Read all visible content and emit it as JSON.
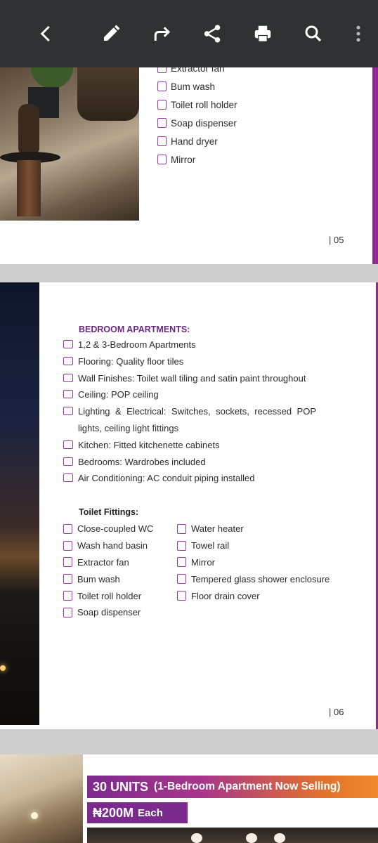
{
  "toolbar": {
    "icons": [
      "back-icon",
      "edit-icon",
      "forward-icon",
      "share-icon",
      "print-icon",
      "search-icon",
      "more-icon"
    ]
  },
  "page5": {
    "items": [
      "Extractor fan",
      "Bum wash",
      "Toilet roll holder",
      "Soap dispenser",
      "Hand dryer",
      "Mirror"
    ],
    "page_number": "| 05"
  },
  "page6": {
    "section_title": "BEDROOM APARTMENTS:",
    "items": [
      "1,2 & 3-Bedroom Apartments",
      "Flooring: Quality floor tiles",
      "Wall Finishes: Toilet wall tiling and satin paint throughout",
      "Ceiling: POP ceiling",
      "Lighting & Electrical: Switches, sockets, recessed POP lights, ceiling light fittings",
      "Kitchen: Fitted kitchenette cabinets",
      "Bedrooms: Wardrobes included",
      "Air Conditioning: AC conduit piping installed"
    ],
    "toilet_title": "Toilet Fittings:",
    "toilet_left": [
      "Close-coupled WC",
      "Wash hand basin",
      "Extractor fan",
      "Bum wash",
      "Toilet roll holder",
      "Soap dispenser"
    ],
    "toilet_right": [
      "Water heater",
      "Towel rail",
      "Mirror",
      "Tempered glass shower enclosure",
      "Floor drain cover"
    ],
    "page_number": "| 06"
  },
  "page7": {
    "units": "30 UNITS",
    "units_note": "(1-Bedroom Apartment Now Selling)",
    "price": "₦200M",
    "price_suffix": "Each"
  },
  "colors": {
    "toolbar": "#2f3132",
    "accent_purple": "#8e2a8e",
    "accent_orange": "#f08a2a"
  }
}
